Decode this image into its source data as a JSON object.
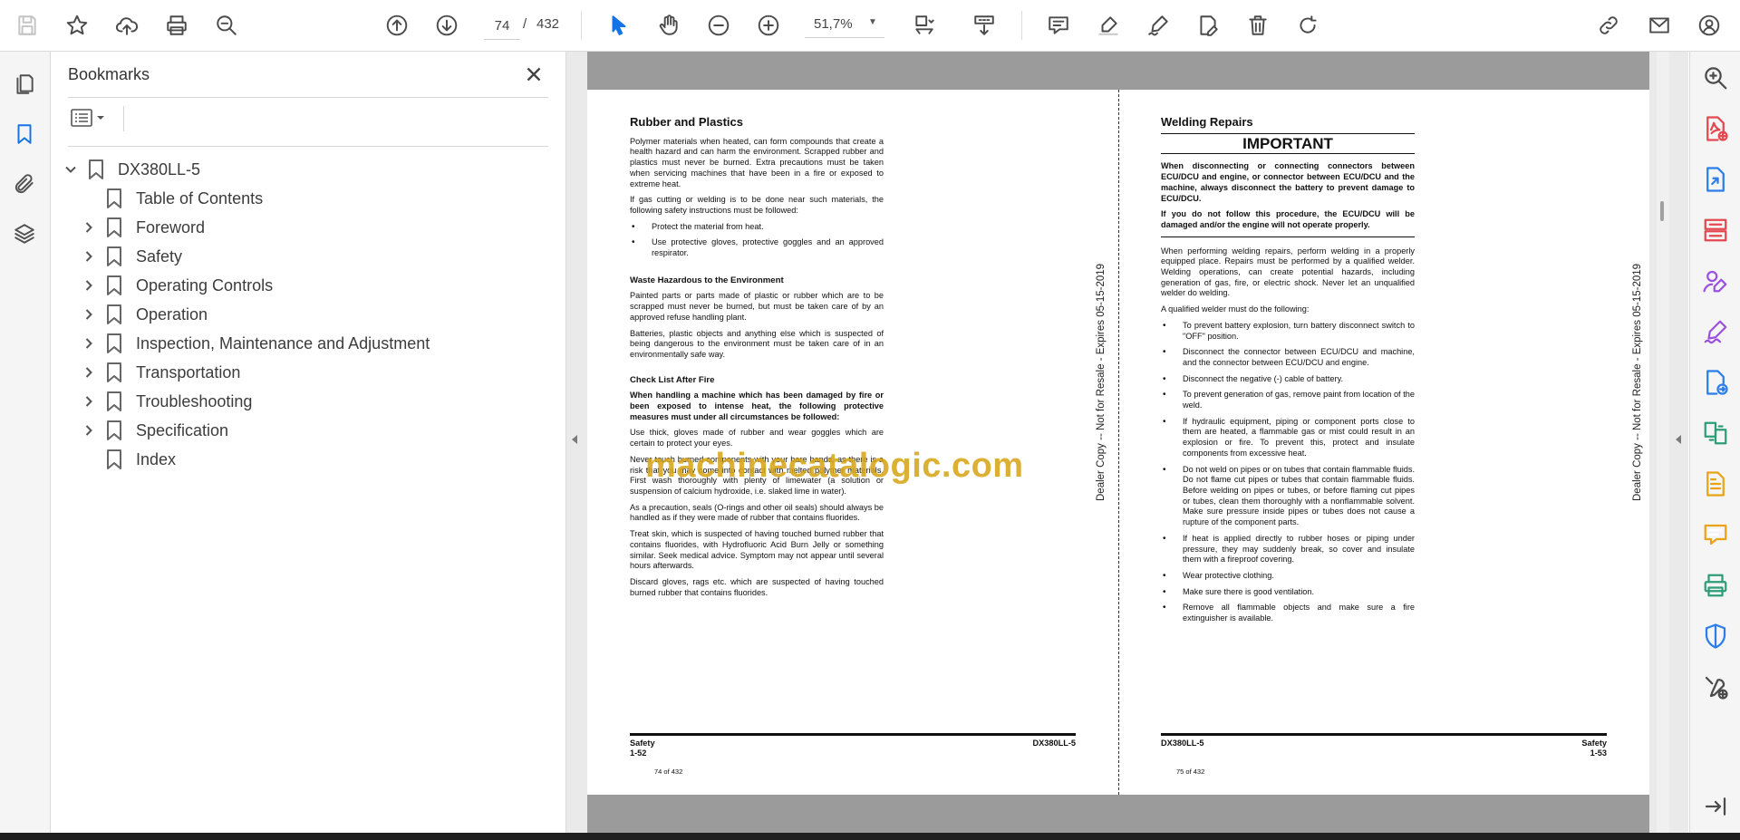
{
  "toolbar": {
    "current_page": "74",
    "page_separator": "/",
    "total_pages": "432",
    "zoom": "51,7%",
    "icons": [
      "save-icon",
      "star-icon",
      "cloud-upload-icon",
      "print-icon",
      "find-icon",
      "previous-page-icon",
      "next-page-icon",
      "select-cursor-icon",
      "hand-tool-icon",
      "zoom-out-icon",
      "zoom-in-icon",
      "page-fit-icon",
      "scroll-mode-icon",
      "comment-icon",
      "highlight-icon",
      "sign-icon",
      "edit-pdf-icon",
      "delete-icon",
      "rotate-icon",
      "share-link-icon",
      "email-icon",
      "account-icon"
    ]
  },
  "left_rail": [
    "page-thumbnails-icon",
    "bookmark-icon",
    "attachment-icon",
    "layers-icon"
  ],
  "bookmarks": {
    "title": "Bookmarks",
    "root": "DX380LL-5",
    "items": [
      {
        "label": "Table of Contents",
        "expandable": false
      },
      {
        "label": "Foreword",
        "expandable": true
      },
      {
        "label": "Safety",
        "expandable": true
      },
      {
        "label": "Operating Controls",
        "expandable": true
      },
      {
        "label": "Operation",
        "expandable": true
      },
      {
        "label": "Inspection, Maintenance and Adjustment",
        "expandable": true
      },
      {
        "label": "Transportation",
        "expandable": true
      },
      {
        "label": "Troubleshooting",
        "expandable": true
      },
      {
        "label": "Specification",
        "expandable": true
      },
      {
        "label": "Index",
        "expandable": false
      }
    ]
  },
  "left_page": {
    "title": "Rubber and Plastics",
    "p1": "Polymer materials when heated, can form compounds that create a health hazard and can harm the environment. Scrapped rubber and plastics must never be burned. Extra precautions must be taken when servicing machines that have been in a fire or exposed to extreme heat.",
    "p2": "If gas cutting or welding is to be done near such materials, the following safety instructions must be followed:",
    "b1": "Protect the material from heat.",
    "b2": "Use protective gloves, protective goggles and an approved respirator.",
    "h_waste": "Waste Hazardous to the Environment",
    "p3": "Painted parts or parts made of plastic or rubber which are to be scrapped must never be burned, but must be taken care of by an approved refuse handling plant.",
    "p4": "Batteries, plastic objects and anything else which is suspected of being dangerous to the environment must be taken care of in an environmentally safe way.",
    "h_check": "Check List After Fire",
    "p5": "When handling a machine which has been damaged by fire or been exposed to intense heat, the following protective measures must under all circumstances be followed:",
    "p6": "Use thick, gloves made of rubber and wear goggles which are certain to protect your eyes.",
    "p7": "Never touch burned components with your bare hands, as there is a risk that you may come into contact with melted polymer materials. First wash thoroughly with plenty of limewater (a solution or suspension of calcium hydroxide, i.e. slaked lime in water).",
    "p8": "As a precaution, seals (O-rings and other oil seals) should always be handled as if they were made of rubber that contains fluorides.",
    "p9": "Treat skin, which is suspected of having touched burned rubber that contains fluorides, with Hydrofluoric Acid Burn Jelly or something similar. Seek medical advice. Symptom may not appear until several hours afterwards.",
    "p10": "Discard gloves, rags etc. which are suspected of having touched burned rubber that contains fluorides.",
    "footer_section": "Safety",
    "footer_page": "1-52",
    "footer_model": "DX380LL-5",
    "page_of": "74 of 432",
    "side_note": "Dealer Copy -- Not for Resale - Expires 05-15-2019"
  },
  "right_page": {
    "title": "Welding Repairs",
    "important": "IMPORTANT",
    "w1": "When disconnecting or connecting connectors between ECU/DCU and engine, or connector between ECU/DCU and the machine, always disconnect the battery to prevent damage to ECU/DCU.",
    "w2": "If you do not follow this procedure, the ECU/DCU will be damaged and/or the engine will not operate properly.",
    "p1": "When performing welding repairs, perform welding in a properly equipped place. Repairs must be performed by a qualified welder. Welding operations, can create potential hazards, including generation of gas, fire, or electric shock. Never let an unqualified welder do welding.",
    "p2": "A qualified welder must do the following:",
    "bullets": [
      "To prevent battery explosion, turn battery disconnect switch to \"OFF\" position.",
      "Disconnect the connector between ECU/DCU and machine, and the connector between ECU/DCU and engine.",
      "Disconnect the negative (-) cable of battery.",
      "To prevent generation of gas, remove paint from location of the weld.",
      "If hydraulic equipment, piping or component ports close to them are heated, a flammable gas or mist could result in an explosion or fire. To prevent this, protect and insulate components from excessive heat.",
      "Do not weld on pipes or on tubes that contain flammable fluids. Do not flame cut pipes or tubes that contain flammable fluids. Before welding on pipes or tubes, or before flaming cut pipes or tubes, clean them thoroughly with a nonflammable solvent. Make sure pressure inside pipes or tubes does not cause a rupture of the component parts.",
      "If heat is applied directly to rubber hoses or piping under pressure, they may suddenly break, so cover and insulate them with a fireproof covering.",
      "Wear protective clothing.",
      "Make sure there is good ventilation.",
      "Remove all flammable objects and make sure a fire extinguisher is available."
    ],
    "footer_model": "DX380LL-5",
    "footer_section": "Safety",
    "footer_page": "1-53",
    "page_of": "75 of 432",
    "side_note": "Dealer Copy -- Not for Resale - Expires 05-15-2019"
  },
  "watermark": "machinecatalogic.com",
  "right_rail": [
    "search-zoom-icon",
    "create-pdf-icon",
    "export-pdf-icon",
    "organize-pages-icon",
    "request-signature-icon",
    "fill-sign-icon",
    "send-for-review-icon",
    "combine-files-icon",
    "scan-icon",
    "comment-tool-icon",
    "print-production-icon",
    "protect-icon",
    "more-tools-icon",
    "expand-panel-icon"
  ],
  "colors": {
    "accent": "#1473e6",
    "watermark": "#d6a518",
    "tool_red": "#e34850",
    "tool_purple": "#9b51e0",
    "tool_blue": "#2b7de9",
    "tool_green": "#2d9d78",
    "tool_yellow": "#e8a317"
  }
}
